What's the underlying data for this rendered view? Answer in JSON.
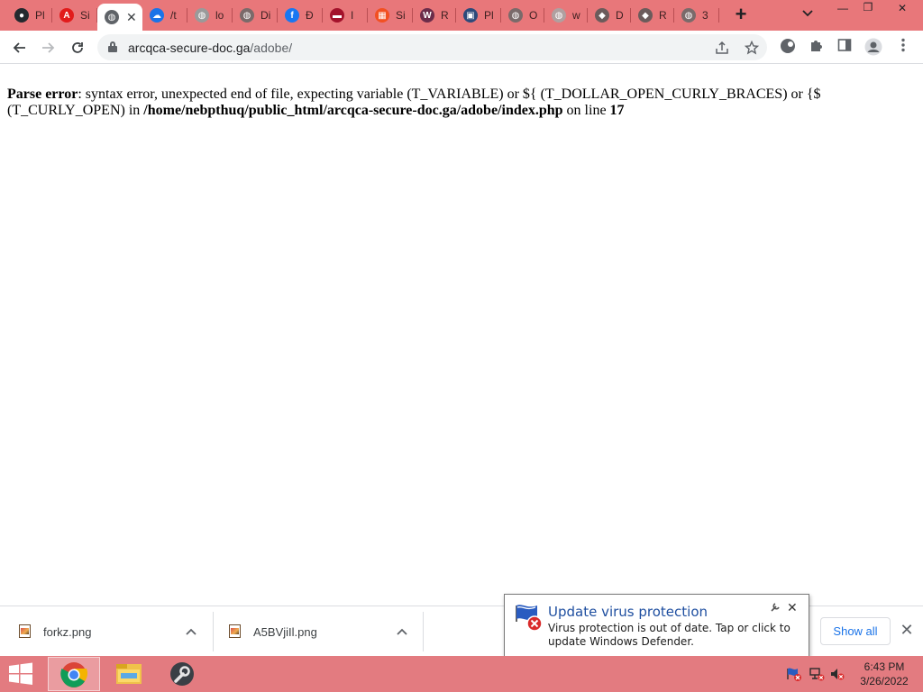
{
  "browser": {
    "tabs": [
      {
        "title": "Pl",
        "icon": "github-icon",
        "color": "#24292e",
        "glyph": "●"
      },
      {
        "title": "Si",
        "icon": "adobe-icon",
        "color": "#e21b1b",
        "glyph": "A"
      },
      {
        "title": "",
        "icon": "globe-icon",
        "color": "#5f6368",
        "glyph": "◍",
        "active": true
      },
      {
        "title": "/t",
        "icon": "cloud-icon",
        "color": "#1a73e8",
        "glyph": "☁"
      },
      {
        "title": "lo",
        "icon": "globe-icon",
        "color": "#9a9a9a",
        "glyph": "◍"
      },
      {
        "title": "Di",
        "icon": "globe-icon",
        "color": "#7a6a6a",
        "glyph": "◍"
      },
      {
        "title": "Đ",
        "icon": "facebook-icon",
        "color": "#1877f2",
        "glyph": "f"
      },
      {
        "title": "Ι",
        "icon": "site-logo-icon",
        "color": "#a3122b",
        "glyph": "▬"
      },
      {
        "title": "Si",
        "icon": "microsoft-icon",
        "color": "#f25022",
        "glyph": "▦"
      },
      {
        "title": "R",
        "icon": "webflow-icon",
        "color": "#6b2c4a",
        "glyph": "W"
      },
      {
        "title": "Pl",
        "icon": "image-icon",
        "color": "#2d4a7a",
        "glyph": "▣"
      },
      {
        "title": "O",
        "icon": "globe-icon",
        "color": "#7a6a6a",
        "glyph": "◍"
      },
      {
        "title": "w",
        "icon": "globe-icon",
        "color": "#b0a0a0",
        "glyph": "◍"
      },
      {
        "title": "D",
        "icon": "app-icon",
        "color": "#6b5b5b",
        "glyph": "◆"
      },
      {
        "title": "R",
        "icon": "app-icon",
        "color": "#6b5b5b",
        "glyph": "◆"
      },
      {
        "title": "3",
        "icon": "globe-icon",
        "color": "#7a6a6a",
        "glyph": "◍"
      }
    ],
    "active_tab_close": "✕",
    "new_tab": "+",
    "tab_search": "⌄",
    "window": {
      "minimize": "—",
      "restore": "❐",
      "close": "✕"
    },
    "url_domain": "arcqca-secure-doc.ga",
    "url_path": "/adobe/",
    "colors": {
      "tabstrip": "#e8777a",
      "taskbar": "#e37b80"
    }
  },
  "page": {
    "error_label": "Parse error",
    "error_message": ": syntax error, unexpected end of file, expecting variable (T_VARIABLE) or ${ (T_DOLLAR_OPEN_CURLY_BRACES) or {$ (T_CURLY_OPEN) in ",
    "error_file": "/home/nebpthuq/public_html/arcqca-secure-doc.ga/adobe/index.php",
    "error_mid": " on line ",
    "error_line": "17"
  },
  "downloads": {
    "items": [
      {
        "name": "forkz.png"
      },
      {
        "name": "A5BVjiIl.png"
      }
    ],
    "show_all": "Show all",
    "close": "✕"
  },
  "notification": {
    "title": "Update virus protection",
    "message": "Virus protection is out of date. Tap or click to update Windows Defender.",
    "close": "✕"
  },
  "taskbar": {
    "apps": [
      "chrome-icon",
      "file-explorer-icon",
      "tools-icon"
    ],
    "time": "6:43 PM",
    "date": "3/26/2022"
  }
}
